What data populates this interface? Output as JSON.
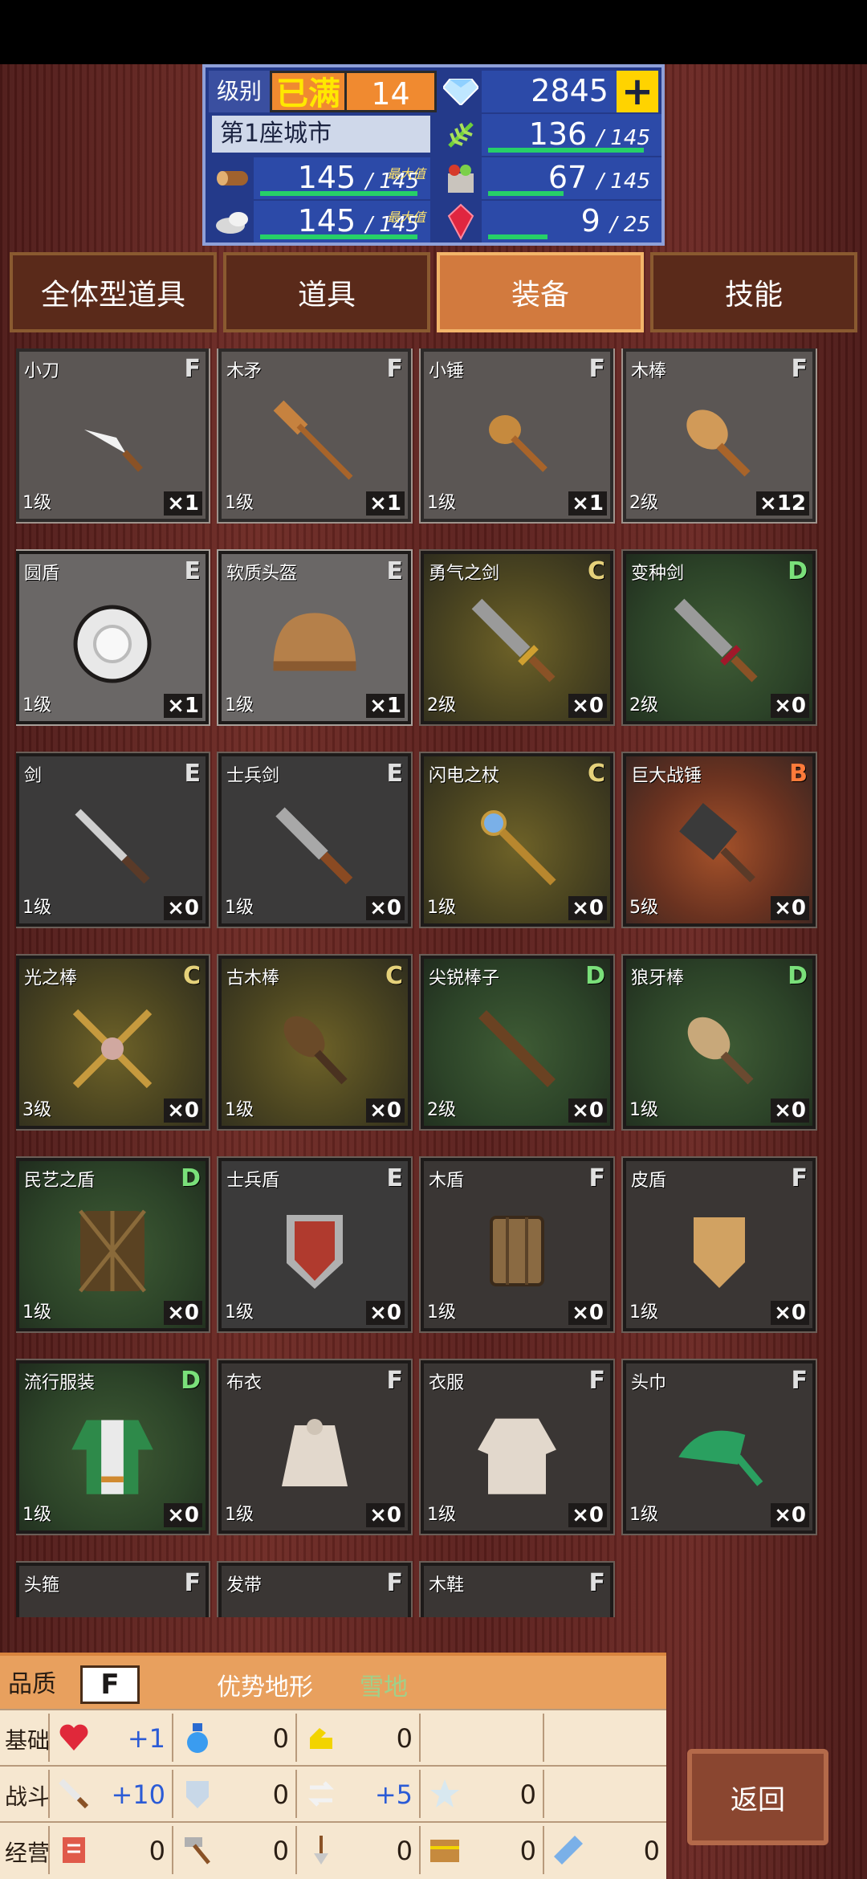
{
  "header": {
    "level_label": "级别",
    "level_max": "已满",
    "level_value": "14",
    "gems": "2845",
    "city": "第1座城市",
    "max_note": "最大值",
    "resources": [
      {
        "icon": "wheat-icon",
        "value": "136",
        "max": "145",
        "fill": 0.94
      },
      {
        "icon": "wood-log-icon",
        "value": "145",
        "max": "145",
        "fill": 1.0
      },
      {
        "icon": "supplies-icon",
        "value": "67",
        "max": "145",
        "fill": 0.46
      },
      {
        "icon": "stone-icon",
        "value": "145",
        "max": "145",
        "fill": 1.0
      },
      {
        "icon": "ruby-icon",
        "value": "9",
        "max": "25",
        "fill": 0.36
      }
    ]
  },
  "tabs": [
    {
      "label": "全体型道具",
      "active": false
    },
    {
      "label": "道具",
      "active": false
    },
    {
      "label": "装备",
      "active": true
    },
    {
      "label": "技能",
      "active": false
    }
  ],
  "items": [
    {
      "name": "小刀",
      "rank": "F",
      "level": "1级",
      "qty": "1",
      "icon": "knife-icon",
      "owned": true
    },
    {
      "name": "木矛",
      "rank": "F",
      "level": "1级",
      "qty": "1",
      "icon": "wooden-spear-icon",
      "owned": true
    },
    {
      "name": "小锤",
      "rank": "F",
      "level": "1级",
      "qty": "1",
      "icon": "small-hammer-icon",
      "owned": true
    },
    {
      "name": "木棒",
      "rank": "F",
      "level": "2级",
      "qty": "12",
      "icon": "wooden-club-icon",
      "owned": true
    },
    {
      "name": "圆盾",
      "rank": "E",
      "level": "1级",
      "qty": "1",
      "icon": "round-shield-icon",
      "owned": true
    },
    {
      "name": "软质头盔",
      "rank": "E",
      "level": "1级",
      "qty": "1",
      "icon": "leather-helmet-icon",
      "owned": true
    },
    {
      "name": "勇气之剑",
      "rank": "C",
      "level": "2级",
      "qty": "0",
      "icon": "sword-of-courage-icon",
      "owned": false
    },
    {
      "name": "变种剑",
      "rank": "D",
      "level": "2级",
      "qty": "0",
      "icon": "mutant-sword-icon",
      "owned": false
    },
    {
      "name": "剑",
      "rank": "E",
      "level": "1级",
      "qty": "0",
      "icon": "sword-icon",
      "owned": false
    },
    {
      "name": "士兵剑",
      "rank": "E",
      "level": "1级",
      "qty": "0",
      "icon": "soldier-sword-icon",
      "owned": false
    },
    {
      "name": "闪电之杖",
      "rank": "C",
      "level": "1级",
      "qty": "0",
      "icon": "lightning-staff-icon",
      "owned": false
    },
    {
      "name": "巨大战锤",
      "rank": "B",
      "level": "5级",
      "qty": "0",
      "icon": "giant-warhammer-icon",
      "owned": false
    },
    {
      "name": "光之棒",
      "rank": "C",
      "level": "3级",
      "qty": "0",
      "icon": "light-rod-icon",
      "owned": false
    },
    {
      "name": "古木棒",
      "rank": "C",
      "level": "1级",
      "qty": "0",
      "icon": "ancient-club-icon",
      "owned": false
    },
    {
      "name": "尖锐棒子",
      "rank": "D",
      "level": "2级",
      "qty": "0",
      "icon": "sharp-stick-icon",
      "owned": false
    },
    {
      "name": "狼牙棒",
      "rank": "D",
      "level": "1级",
      "qty": "0",
      "icon": "spiked-club-icon",
      "owned": false
    },
    {
      "name": "民艺之盾",
      "rank": "D",
      "level": "1级",
      "qty": "0",
      "icon": "folk-shield-icon",
      "owned": false
    },
    {
      "name": "士兵盾",
      "rank": "E",
      "level": "1级",
      "qty": "0",
      "icon": "soldier-shield-icon",
      "owned": false
    },
    {
      "name": "木盾",
      "rank": "F",
      "level": "1级",
      "qty": "0",
      "icon": "wooden-shield-icon",
      "owned": false
    },
    {
      "name": "皮盾",
      "rank": "F",
      "level": "1级",
      "qty": "0",
      "icon": "leather-shield-icon",
      "owned": false
    },
    {
      "name": "流行服装",
      "rank": "D",
      "level": "1级",
      "qty": "0",
      "icon": "trendy-clothes-icon",
      "owned": false
    },
    {
      "name": "布衣",
      "rank": "F",
      "level": "1级",
      "qty": "0",
      "icon": "cloth-shirt-icon",
      "owned": false
    },
    {
      "name": "衣服",
      "rank": "F",
      "level": "1级",
      "qty": "0",
      "icon": "clothes-icon",
      "owned": false
    },
    {
      "name": "头巾",
      "rank": "F",
      "level": "1级",
      "qty": "0",
      "icon": "bandana-icon",
      "owned": false
    },
    {
      "name": "头箍",
      "rank": "F",
      "level": "",
      "qty": "",
      "icon": "headband-icon",
      "owned": false
    },
    {
      "name": "发带",
      "rank": "F",
      "level": "",
      "qty": "",
      "icon": "hair-ribbon-icon",
      "owned": false
    },
    {
      "name": "木鞋",
      "rank": "F",
      "level": "",
      "qty": "",
      "icon": "wooden-shoes-icon",
      "owned": false
    }
  ],
  "info": {
    "quality_label": "品质",
    "quality_value": "F",
    "terrain_label": "优势地形",
    "terrain_value": "雪地",
    "rows": [
      {
        "category": "基础",
        "stats": [
          {
            "icon": "heart-icon",
            "value": "+1",
            "pos": true
          },
          {
            "icon": "potion-icon",
            "value": "0",
            "pos": false
          },
          {
            "icon": "strength-arm-icon",
            "value": "0",
            "pos": false
          }
        ]
      },
      {
        "category": "战斗",
        "stats": [
          {
            "icon": "attack-sword-icon",
            "value": "+10",
            "pos": true
          },
          {
            "icon": "defense-shield-icon",
            "value": "0",
            "pos": false
          },
          {
            "icon": "speed-arrows-icon",
            "value": "+5",
            "pos": true
          },
          {
            "icon": "star-icon",
            "value": "0",
            "pos": false
          }
        ]
      },
      {
        "category": "经营",
        "stats": [
          {
            "icon": "book-icon",
            "value": "0",
            "pos": false
          },
          {
            "icon": "hammer-tool-icon",
            "value": "0",
            "pos": false
          },
          {
            "icon": "shovel-icon",
            "value": "0",
            "pos": false
          },
          {
            "icon": "chest-icon",
            "value": "0",
            "pos": false
          },
          {
            "icon": "crystal-icon",
            "value": "0",
            "pos": false
          }
        ]
      }
    ]
  },
  "back_label": "返回"
}
